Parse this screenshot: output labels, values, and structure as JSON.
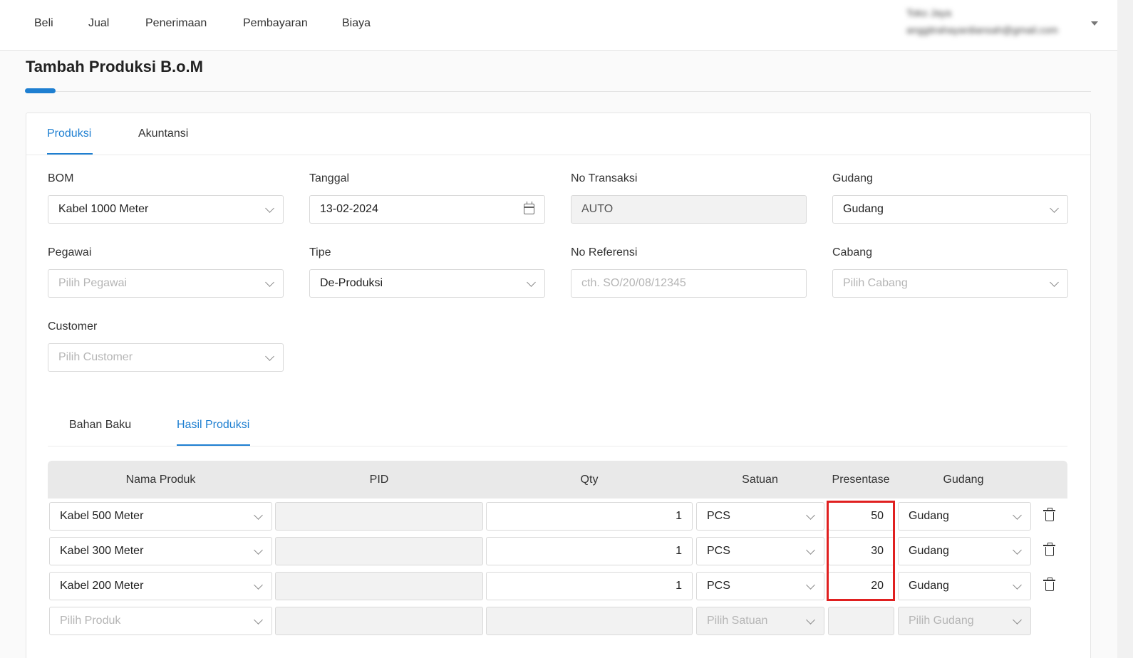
{
  "nav": {
    "items": [
      "Beli",
      "Jual",
      "Penerimaan",
      "Pembayaran",
      "Biaya"
    ],
    "user_name": "Toko Jaya",
    "user_email": "anggitrahayardiansah@gmail.com"
  },
  "page": {
    "title": "Tambah Produksi B.o.M"
  },
  "tabs": [
    "Produksi",
    "Akuntansi"
  ],
  "form": {
    "bom": {
      "label": "BOM",
      "value": "Kabel 1000 Meter"
    },
    "tanggal": {
      "label": "Tanggal",
      "value": "13-02-2024"
    },
    "no_transaksi": {
      "label": "No Transaksi",
      "value": "AUTO"
    },
    "gudang": {
      "label": "Gudang",
      "value": "Gudang"
    },
    "pegawai": {
      "label": "Pegawai",
      "placeholder": "Pilih Pegawai"
    },
    "tipe": {
      "label": "Tipe",
      "value": "De-Produksi"
    },
    "no_referensi": {
      "label": "No Referensi",
      "placeholder": "cth. SO/20/08/12345"
    },
    "cabang": {
      "label": "Cabang",
      "placeholder": "Pilih Cabang"
    },
    "customer": {
      "label": "Customer",
      "placeholder": "Pilih Customer"
    }
  },
  "subtabs": [
    "Bahan Baku",
    "Hasil Produksi"
  ],
  "table": {
    "headers": [
      "Nama Produk",
      "PID",
      "Qty",
      "Satuan",
      "Presentase",
      "Gudang"
    ],
    "rows": [
      {
        "produk": "Kabel 500 Meter",
        "pid": "",
        "qty": "1",
        "satuan": "PCS",
        "presentase": "50",
        "gudang": "Gudang"
      },
      {
        "produk": "Kabel 300 Meter",
        "pid": "",
        "qty": "1",
        "satuan": "PCS",
        "presentase": "30",
        "gudang": "Gudang"
      },
      {
        "produk": "Kabel 200 Meter",
        "pid": "",
        "qty": "1",
        "satuan": "PCS",
        "presentase": "20",
        "gudang": "Gudang"
      }
    ],
    "new_row": {
      "produk_placeholder": "Pilih Produk",
      "satuan_placeholder": "Pilih Satuan",
      "gudang_placeholder": "Pilih Gudang"
    }
  },
  "colors": {
    "accent": "#1e7fd1",
    "highlight": "#e02020"
  }
}
